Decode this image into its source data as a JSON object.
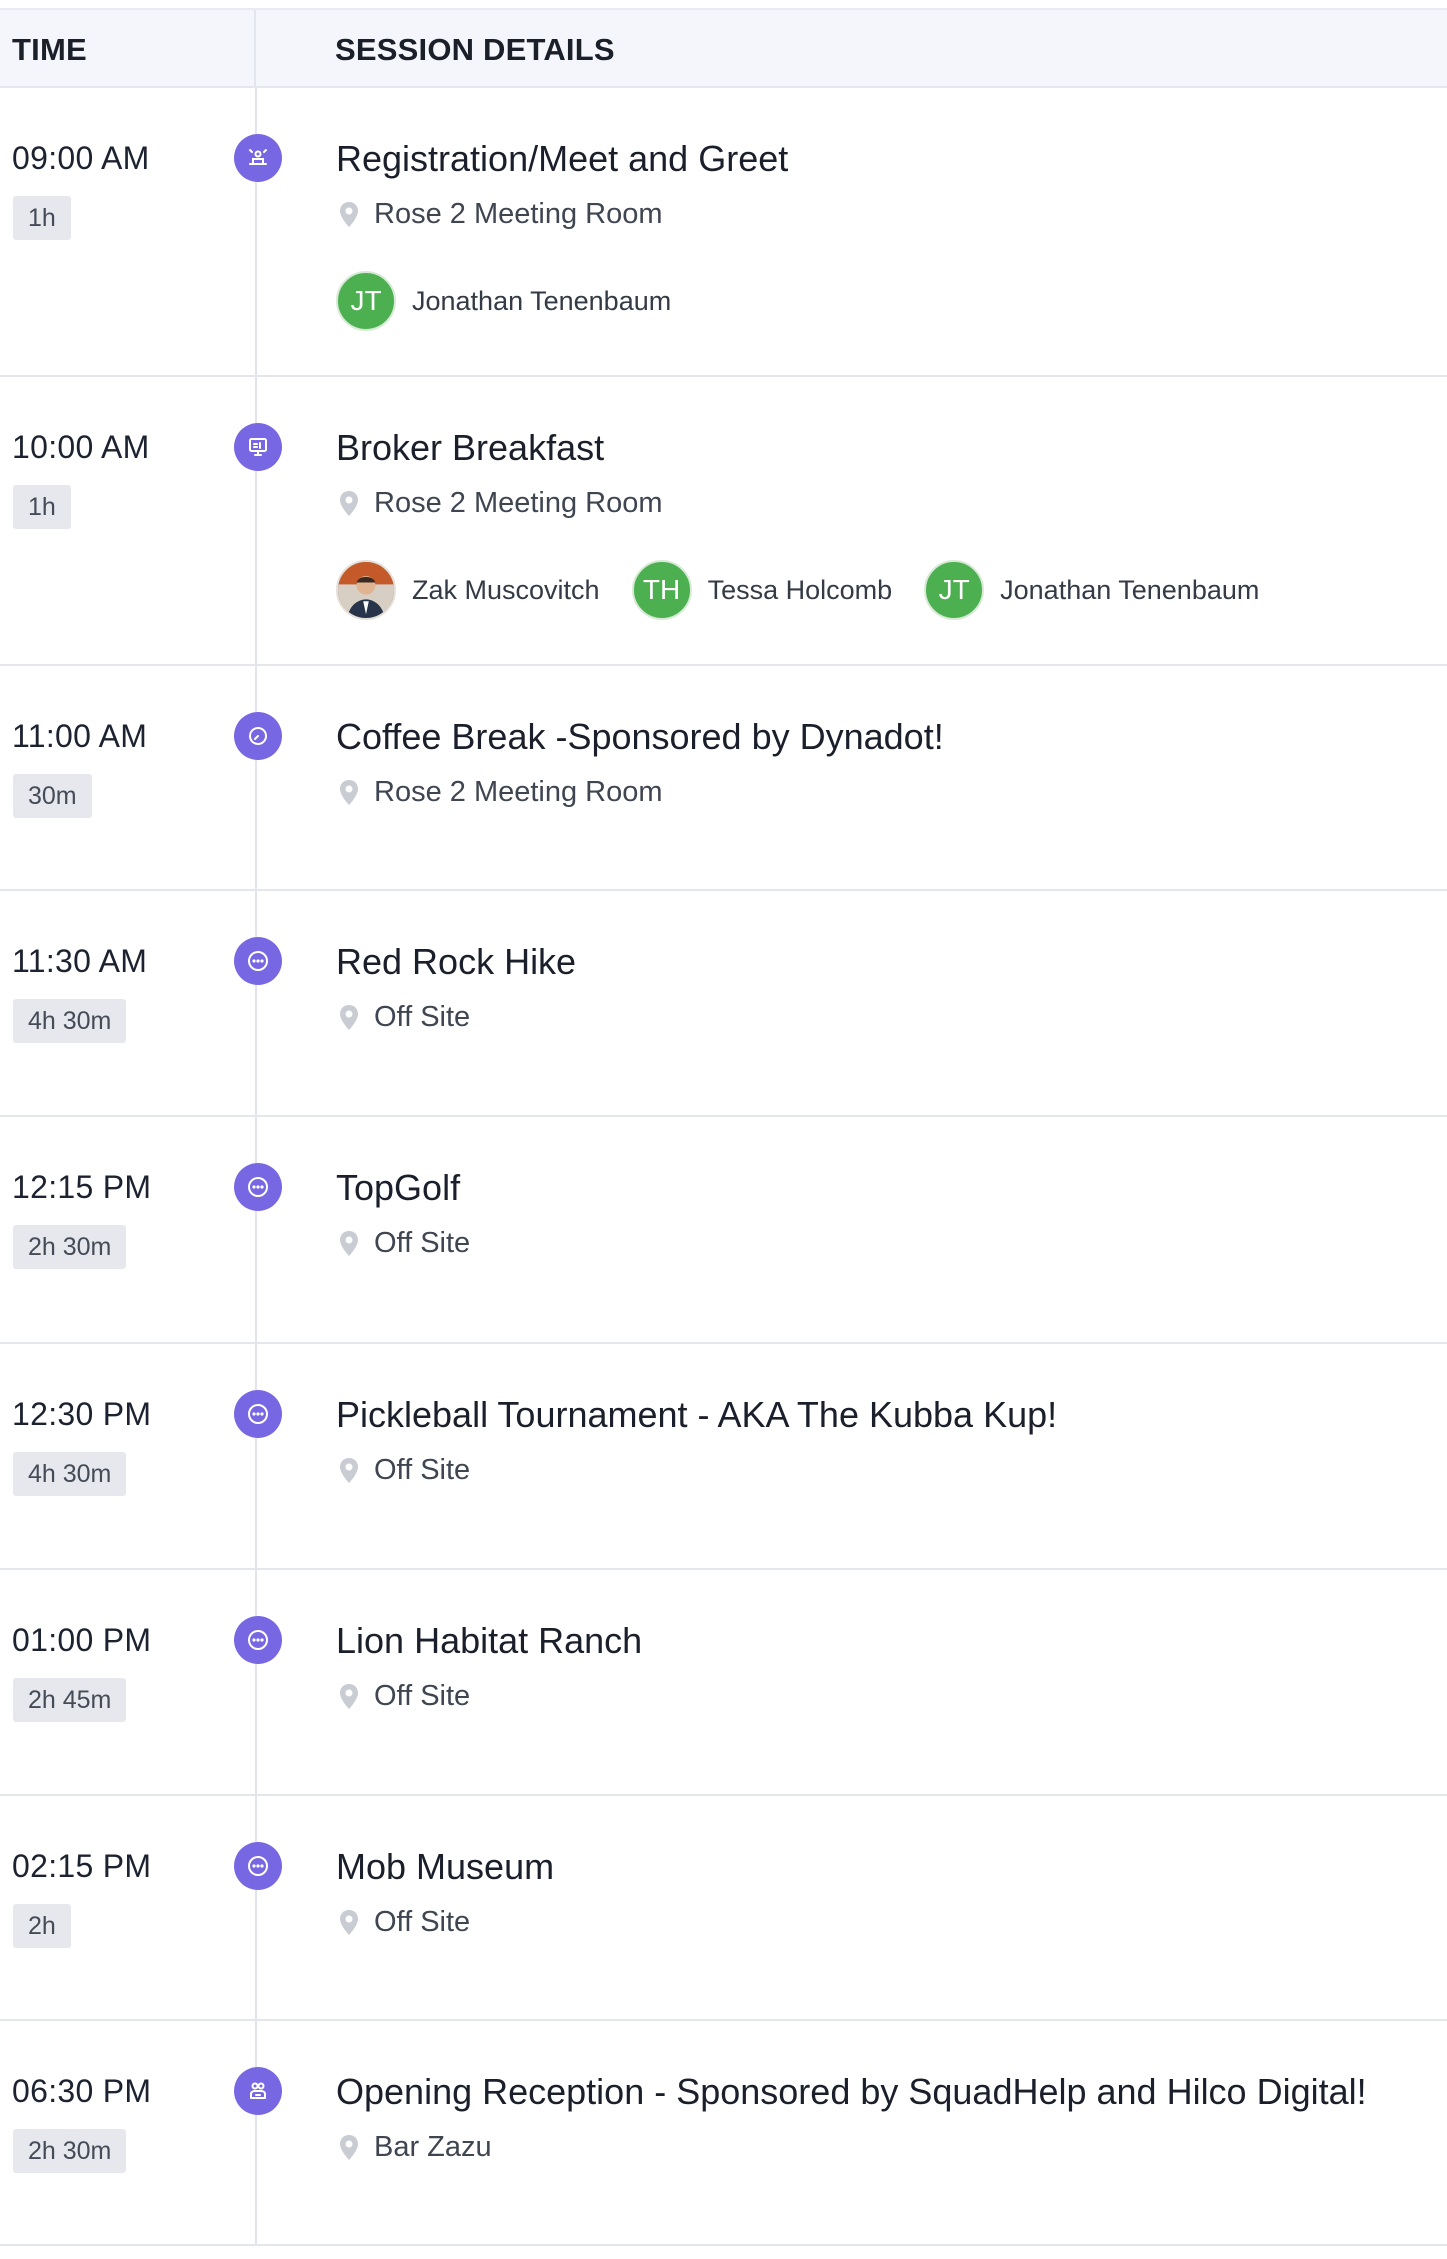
{
  "header": {
    "time_label": "TIME",
    "details_label": "SESSION DETAILS"
  },
  "sessions": [
    {
      "time": "09:00 AM",
      "duration": "1h",
      "icon": "registration-icon",
      "title": "Registration/Meet and Greet",
      "location": "Rose 2 Meeting Room",
      "speakers": [
        {
          "initials": "JT",
          "name": "Jonathan Tenenbaum"
        }
      ]
    },
    {
      "time": "10:00 AM",
      "duration": "1h",
      "icon": "presentation-icon",
      "title": "Broker Breakfast",
      "location": "Rose 2 Meeting Room",
      "speakers": [
        {
          "initials": "",
          "name": "Zak Muscovitch"
        },
        {
          "initials": "TH",
          "name": "Tessa Holcomb"
        },
        {
          "initials": "JT",
          "name": "Jonathan Tenenbaum"
        }
      ]
    },
    {
      "time": "11:00 AM",
      "duration": "30m",
      "icon": "break-icon",
      "title": "Coffee Break -Sponsored by Dynadot!",
      "location": "Rose 2 Meeting Room"
    },
    {
      "time": "11:30 AM",
      "duration": "4h 30m",
      "icon": "more-icon",
      "title": "Red Rock Hike",
      "location": "Off Site"
    },
    {
      "time": "12:15 PM",
      "duration": "2h 30m",
      "icon": "more-icon",
      "title": "TopGolf",
      "location": "Off Site"
    },
    {
      "time": "12:30 PM",
      "duration": "4h 30m",
      "icon": "more-icon",
      "title": "Pickleball Tournament - AKA The Kubba Kup!",
      "location": "Off Site"
    },
    {
      "time": "01:00 PM",
      "duration": "2h 45m",
      "icon": "more-icon",
      "title": "Lion Habitat Ranch",
      "location": "Off Site"
    },
    {
      "time": "02:15 PM",
      "duration": "2h",
      "icon": "more-icon",
      "title": "Mob Museum",
      "location": "Off Site"
    },
    {
      "time": "06:30 PM",
      "duration": "2h 30m",
      "icon": "reception-icon",
      "title": "Opening Reception - Sponsored by SquadHelp and Hilco Digital!",
      "location": "Bar Zazu"
    }
  ],
  "colors": {
    "accent": "#7867e2",
    "avatar_green": "#4caf50",
    "header_bg": "#f4f6fb"
  }
}
